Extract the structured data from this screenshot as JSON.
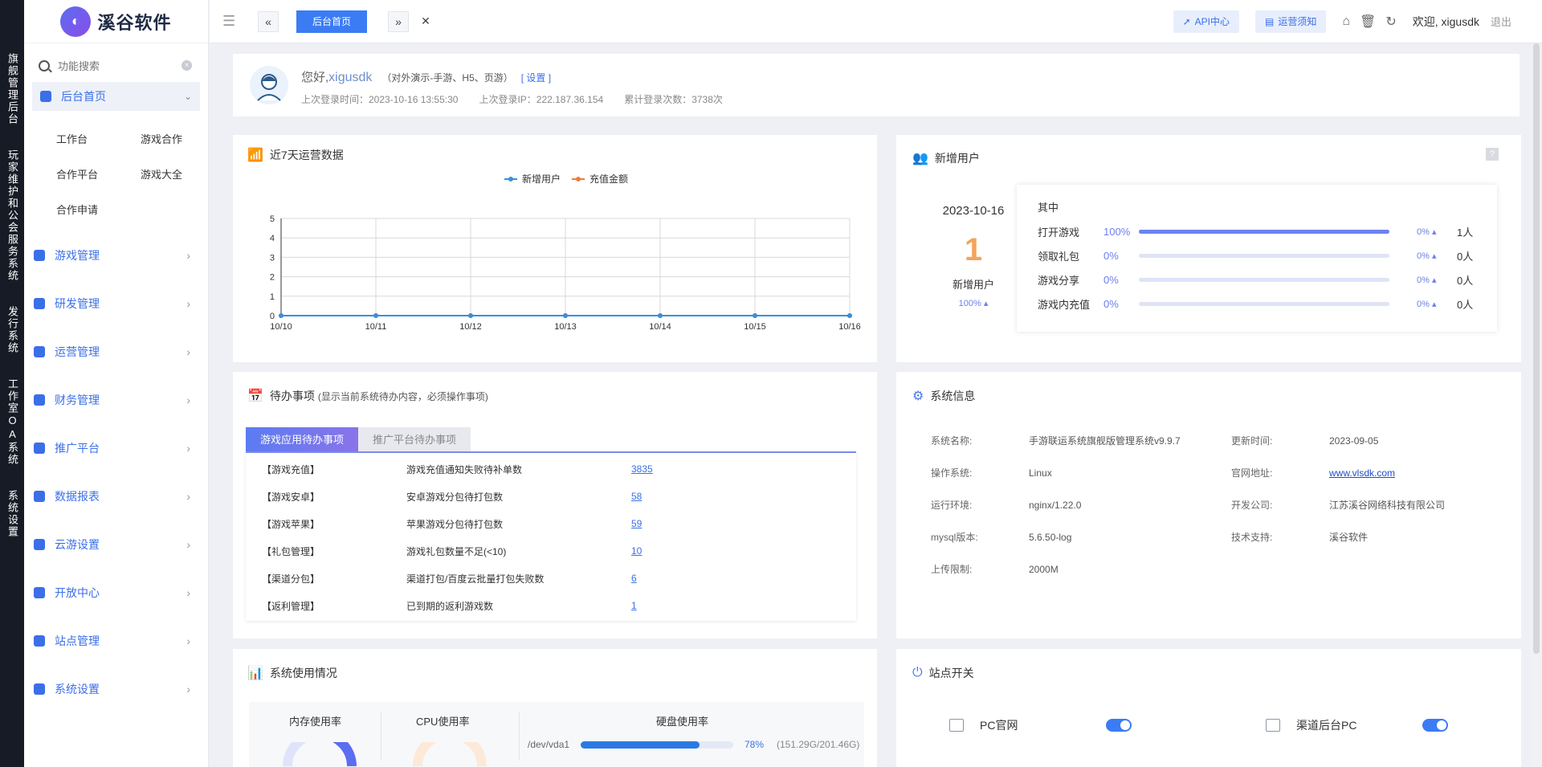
{
  "vertical_nav": [
    "旗舰管理后台",
    "玩家维护和公会服务系统",
    "发行系统",
    "工作室OA系统",
    "系统设置"
  ],
  "brand": {
    "name": "溪谷软件"
  },
  "search": {
    "placeholder": "功能搜索"
  },
  "menu": {
    "active": "后台首页",
    "sub": [
      "工作台",
      "游戏合作",
      "合作平台",
      "游戏大全",
      "合作申请"
    ],
    "items": [
      "游戏管理",
      "研发管理",
      "运营管理",
      "财务管理",
      "推广平台",
      "数据报表",
      "云游设置",
      "开放中心",
      "站点管理",
      "系统设置"
    ]
  },
  "topbar": {
    "active_tab": "后台首页",
    "api_label": "API中心",
    "notice_label": "运营须知",
    "welcome": "欢迎, xigusdk",
    "logout": "退出"
  },
  "profile": {
    "greeting": "您好,",
    "username": "xigusdk",
    "role": "（对外演示-手游、H5、页游）",
    "settings": "[ 设置 ]",
    "last_login_time": "上次登录时间：2023-10-16 13:55:30",
    "last_login_ip": "上次登录IP：222.187.36.154",
    "login_count": "累计登录次数：3738次"
  },
  "ops_chart": {
    "title": "近7天运营数据"
  },
  "chart_data": {
    "type": "line",
    "x": [
      "10/10",
      "10/11",
      "10/12",
      "10/13",
      "10/14",
      "10/15",
      "10/16"
    ],
    "series": [
      {
        "name": "新增用户",
        "values": [
          0,
          0,
          0,
          0,
          0,
          0,
          0
        ],
        "color": "#3b8fd9"
      },
      {
        "name": "充值金额",
        "values": [
          0,
          0,
          0,
          0,
          0,
          0,
          0
        ],
        "color": "#f07a3a"
      }
    ],
    "yticks": [
      "0",
      "1",
      "2",
      "3",
      "4",
      "5"
    ],
    "ylim": [
      0,
      5
    ],
    "legend": "top-center",
    "grid": true
  },
  "new_users": {
    "title": "新增用户",
    "help": "?",
    "date": "2023-10-16",
    "count": "1",
    "label": "新增用户",
    "growth": "100%",
    "breakdown_title": "其中",
    "rows": [
      {
        "name": "打开游戏",
        "pct": "100%",
        "fill": 1.0,
        "change": "0%",
        "count": "1人"
      },
      {
        "name": "领取礼包",
        "pct": "0%",
        "fill": 0,
        "change": "0%",
        "count": "0人"
      },
      {
        "name": "游戏分享",
        "pct": "0%",
        "fill": 0,
        "change": "0%",
        "count": "0人"
      },
      {
        "name": "游戏内充值",
        "pct": "0%",
        "fill": 0,
        "change": "0%",
        "count": "0人"
      }
    ]
  },
  "todo": {
    "title": "待办事项",
    "subtitle": "(显示当前系统待办内容，必须操作事项)",
    "tabs": [
      "游戏应用待办事项",
      "推广平台待办事项"
    ],
    "rows": [
      {
        "cat": "【游戏充值】",
        "desc": "游戏充值通知失败待补单数",
        "num": "3835"
      },
      {
        "cat": "【游戏安卓】",
        "desc": "安卓游戏分包待打包数",
        "num": "58"
      },
      {
        "cat": "【游戏苹果】",
        "desc": "苹果游戏分包待打包数",
        "num": "59"
      },
      {
        "cat": "【礼包管理】",
        "desc": "游戏礼包数量不足(<10)",
        "num": "10"
      },
      {
        "cat": "【渠道分包】",
        "desc": "渠道打包/百度云批量打包失败数",
        "num": "6"
      },
      {
        "cat": "【返利管理】",
        "desc": "已到期的返利游戏数",
        "num": "1"
      }
    ]
  },
  "sysinfo": {
    "title": "系统信息",
    "left": [
      {
        "k": "系统名称:",
        "v": "手游联运系统旗舰版管理系统v9.9.7"
      },
      {
        "k": "操作系统:",
        "v": "Linux"
      },
      {
        "k": "运行环境:",
        "v": "nginx/1.22.0"
      },
      {
        "k": "mysql版本:",
        "v": "5.6.50-log"
      },
      {
        "k": "上传限制:",
        "v": "2000M"
      }
    ],
    "right": [
      {
        "k": "更新时间:",
        "v": "2023-09-05"
      },
      {
        "k": "官网地址:",
        "v": "www.vlsdk.com"
      },
      {
        "k": "开发公司:",
        "v": "江苏溪谷网络科技有限公司"
      },
      {
        "k": "技术支持:",
        "v": "溪谷软件"
      }
    ]
  },
  "usage": {
    "title": "系统使用情况",
    "mem": "内存使用率",
    "cpu": "CPU使用率",
    "disk": "硬盘使用率",
    "disk_dev": "/dev/vda1",
    "disk_pct": "78%",
    "disk_fill": 0.78,
    "disk_size": "(151.29G/201.46G)"
  },
  "site_switch": {
    "title": "站点开关",
    "items": [
      {
        "label": "PC官网",
        "on": true
      },
      {
        "label": "渠道后台PC",
        "on": true
      }
    ]
  }
}
